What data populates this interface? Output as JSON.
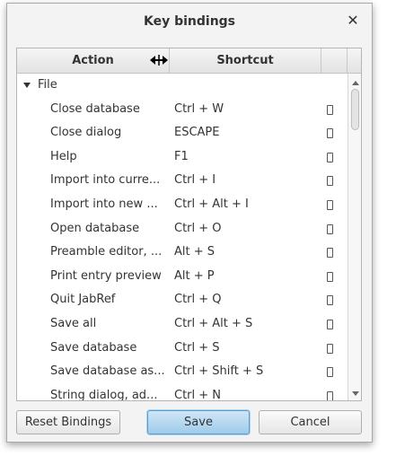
{
  "dialog": {
    "title": "Key bindings",
    "close_icon": "close-icon"
  },
  "table": {
    "columns": [
      "Action",
      "Shortcut",
      ""
    ],
    "group": {
      "label": "File",
      "expanded": true
    },
    "rows": [
      {
        "action": "Close database",
        "shortcut": "Ctrl + W"
      },
      {
        "action": "Close dialog",
        "shortcut": "ESCAPE"
      },
      {
        "action": "Help",
        "shortcut": "F1"
      },
      {
        "action": "Import into curre...",
        "shortcut": "Ctrl + I"
      },
      {
        "action": "Import into new ...",
        "shortcut": "Ctrl + Alt + I"
      },
      {
        "action": "Open database",
        "shortcut": "Ctrl + O"
      },
      {
        "action": "Preamble editor, ...",
        "shortcut": "Alt + S"
      },
      {
        "action": "Print entry preview",
        "shortcut": "Alt + P"
      },
      {
        "action": "Quit JabRef",
        "shortcut": "Ctrl + Q"
      },
      {
        "action": "Save all",
        "shortcut": "Ctrl + Alt + S"
      },
      {
        "action": "Save database",
        "shortcut": "Ctrl + S"
      },
      {
        "action": "Save database as...",
        "shortcut": "Ctrl + Shift + S"
      },
      {
        "action": "String dialog, ad...",
        "shortcut": "Ctrl + N"
      }
    ]
  },
  "buttons": {
    "reset": "Reset Bindings",
    "save": "Save",
    "cancel": "Cancel"
  },
  "colors": {
    "accent": "#9fcbe9",
    "dialog_bg": "#f3f3f3"
  }
}
